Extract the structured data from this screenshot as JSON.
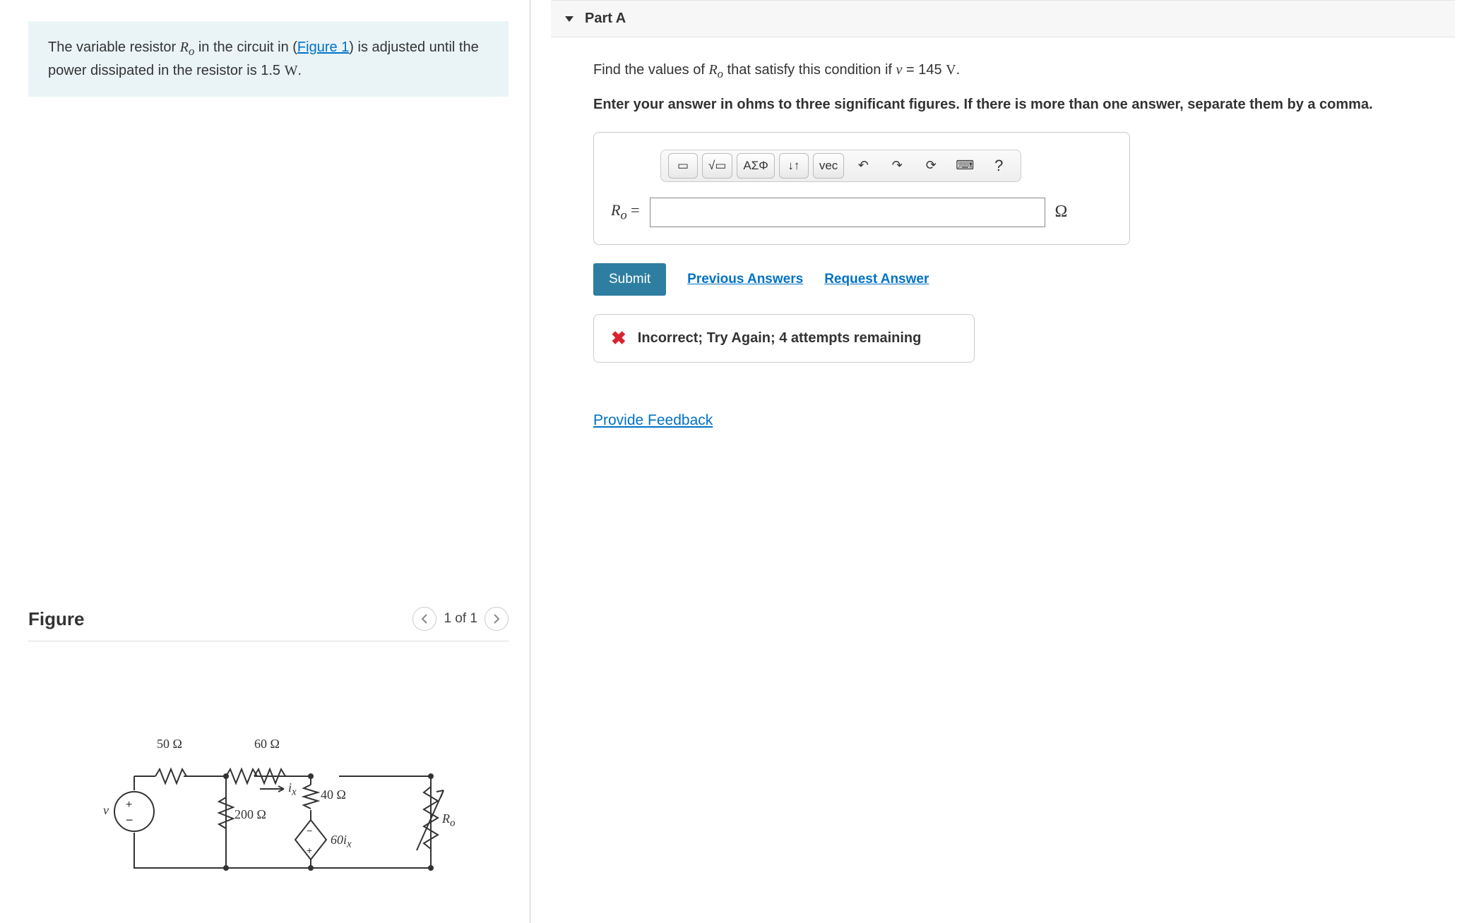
{
  "problem": {
    "text_a": "The variable resistor ",
    "var1": "R",
    "var1_sub": "o",
    "text_b": " in the circuit in (",
    "figure_link": "Figure 1",
    "text_c": ") is adjusted until the power dissipated in the resistor is 1.5 ",
    "watt": "W",
    "text_d": "."
  },
  "figure": {
    "title": "Figure",
    "pager_text": "1 of 1",
    "labels": {
      "r50": "50 Ω",
      "r60": "60 Ω",
      "r200": "200 Ω",
      "r40": "40 Ω",
      "ix": "i",
      "ix_sub": "x",
      "ccvs": "60i",
      "ccvs_sub": "x",
      "v": "v",
      "ro": "R",
      "ro_sub": "o"
    }
  },
  "part": {
    "label": "Part A",
    "question_a": "Find the values of ",
    "var1": "R",
    "var1_sub": "o",
    "question_b": " that satisfy this condition if ",
    "v_var": "v",
    "equals": " = 145 ",
    "volt": "V",
    "question_c": ".",
    "instructions": "Enter your answer in ohms to three significant figures. If there is more than one answer, separate them by a comma."
  },
  "toolbar": {
    "template": "▭",
    "frac": "√▭",
    "greek": "ΑΣΦ",
    "arrows": "↓↑",
    "vec": "vec",
    "undo": "↶",
    "redo": "↷",
    "reset": "⟳",
    "keyboard": "⌨",
    "help": "?"
  },
  "answer": {
    "label_var": "R",
    "label_sub": "o",
    "label_eq": " =",
    "value": "",
    "unit": "Ω"
  },
  "actions": {
    "submit": "Submit",
    "previous": "Previous Answers",
    "request": "Request Answer"
  },
  "feedback": {
    "text": "Incorrect; Try Again; 4 attempts remaining"
  },
  "provide_feedback": "Provide Feedback"
}
